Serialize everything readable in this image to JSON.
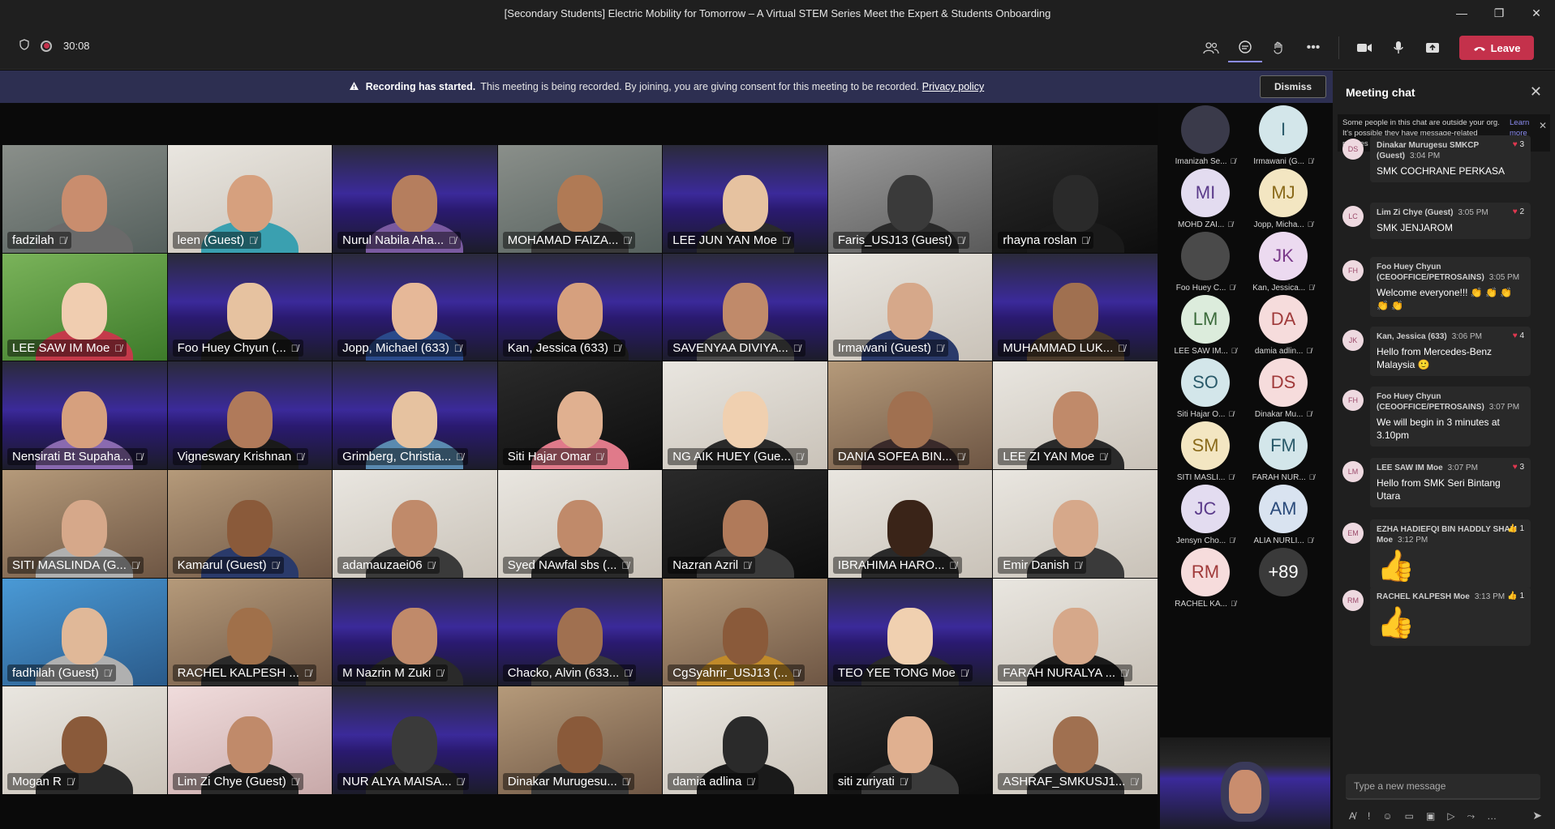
{
  "window": {
    "title": "[Secondary Students] Electric Mobility for Tomorrow – A Virtual STEM Series Meet the Expert & Students Onboarding",
    "minimize": "—",
    "maximize": "❐",
    "close": "✕"
  },
  "toolbar": {
    "timer": "30:08",
    "leave_label": "Leave",
    "icons": [
      "shield-icon",
      "record-icon",
      "participants-icon",
      "chat-icon",
      "reactions-icon",
      "more-icon",
      "camera-icon",
      "mic-icon",
      "share-icon",
      "phone-icon"
    ]
  },
  "banner": {
    "title": "Recording has started.",
    "message": "This meeting is being recorded. By joining, you are giving consent for this meeting to be recorded.",
    "link": "Privacy policy",
    "dismiss": "Dismiss"
  },
  "tiles": [
    {
      "name": "fadzilah",
      "bg": "bg-room",
      "skin": "#c98d6e",
      "cloth": "#6a6a6a"
    },
    {
      "name": "leen (Guest)",
      "bg": "bg-light",
      "skin": "#d6a07e",
      "cloth": "#3aa0b0"
    },
    {
      "name": "Nurul Nabila Aha...",
      "bg": "bg-purple",
      "skin": "#b57e5e",
      "cloth": "#7a5aa0"
    },
    {
      "name": "MOHAMAD FAIZA...",
      "bg": "bg-room",
      "skin": "#b07a55",
      "cloth": "#3a3a3a"
    },
    {
      "name": "LEE JUN YAN Moe",
      "bg": "bg-purple",
      "skin": "#e6c2a0",
      "cloth": "#2a2a2a"
    },
    {
      "name": "Faris_USJ13 (Guest)",
      "bg": "bg-grey",
      "skin": "#3a3a3a",
      "cloth": "#2a2a2a"
    },
    {
      "name": "rhayna roslan",
      "bg": "bg-dark",
      "skin": "#2a2a2a",
      "cloth": "#1a1a1a"
    },
    {
      "name": "LEE SAW IM Moe",
      "bg": "bg-green",
      "skin": "#f0cdb0",
      "cloth": "#c43a4a"
    },
    {
      "name": "Foo Huey Chyun (...",
      "bg": "bg-purple",
      "skin": "#e6c2a0",
      "cloth": "#1a1a1a"
    },
    {
      "name": "Jopp, Michael (633)",
      "bg": "bg-purple",
      "skin": "#e6b898",
      "cloth": "#2a4a8a"
    },
    {
      "name": "Kan, Jessica (633)",
      "bg": "bg-purple",
      "skin": "#d6a07e",
      "cloth": "#1a1a1a"
    },
    {
      "name": "SAVENYAA DIVIYA...",
      "bg": "bg-purple",
      "skin": "#c08a6a",
      "cloth": "#4a4a4a"
    },
    {
      "name": "Irmawani (Guest)",
      "bg": "bg-light",
      "skin": "#d6a88a",
      "cloth": "#2a3a6a"
    },
    {
      "name": "MUHAMMAD LUK...",
      "bg": "bg-purple",
      "skin": "#a07050",
      "cloth": "#4a3a2a"
    },
    {
      "name": "Nensirati Bt Supaha...",
      "bg": "bg-purple",
      "skin": "#d6a07e",
      "cloth": "#8a6ab0"
    },
    {
      "name": "Vigneswary Krishnan",
      "bg": "bg-purple",
      "skin": "#b07a5a",
      "cloth": "#1a1a1a"
    },
    {
      "name": "Grimberg, Christia...",
      "bg": "bg-purple",
      "skin": "#e6c2a0",
      "cloth": "#5a8ab0"
    },
    {
      "name": "Siti Hajar Omar",
      "bg": "bg-dark",
      "skin": "#e0b090",
      "cloth": "#e07a8a"
    },
    {
      "name": "NG AIK HUEY (Gue...",
      "bg": "bg-light",
      "skin": "#f0d0b0",
      "cloth": "#2a2a2a"
    },
    {
      "name": "DANIA SOFEA BIN...",
      "bg": "bg-warm",
      "skin": "#a07050",
      "cloth": "#3a2a2a"
    },
    {
      "name": "LEE ZI YAN Moe",
      "bg": "bg-light",
      "skin": "#c08a6a",
      "cloth": "#2a2a2a"
    },
    {
      "name": "SITI MASLINDA (G...",
      "bg": "bg-warm",
      "skin": "#d6a88a",
      "cloth": "#b0b0b0"
    },
    {
      "name": "Kamarul (Guest)",
      "bg": "bg-warm",
      "skin": "#8a5a3a",
      "cloth": "#2a3a6a"
    },
    {
      "name": "adamauzaei06",
      "bg": "bg-light",
      "skin": "#c08a6a",
      "cloth": "#3a3a3a"
    },
    {
      "name": "Syed NAwfal sbs (...",
      "bg": "bg-light",
      "skin": "#c08a6a",
      "cloth": "#2a2a2a"
    },
    {
      "name": "Nazran Azril",
      "bg": "bg-dark",
      "skin": "#b07a5a",
      "cloth": "#3a3a3a"
    },
    {
      "name": "IBRAHIMA HARO...",
      "bg": "bg-light",
      "skin": "#3a2418",
      "cloth": "#2a2a2a"
    },
    {
      "name": "Emir Danish",
      "bg": "bg-light",
      "skin": "#d6a88a",
      "cloth": "#3a3a3a"
    },
    {
      "name": "fadhilah (Guest)",
      "bg": "bg-blue",
      "skin": "#e0b898",
      "cloth": "#b0b0b0"
    },
    {
      "name": "RACHEL KALPESH ...",
      "bg": "bg-warm",
      "skin": "#a0704a",
      "cloth": "#2a2a2a"
    },
    {
      "name": "M Nazrin M Zuki",
      "bg": "bg-purple",
      "skin": "#c08a6a",
      "cloth": "#2a2a2a"
    },
    {
      "name": "Chacko, Alvin (633...",
      "bg": "bg-purple",
      "skin": "#a07050",
      "cloth": "#3a3a3a"
    },
    {
      "name": "CgSyahrir_USJ13 (...",
      "bg": "bg-warm",
      "skin": "#8a5a3a",
      "cloth": "#c08a2a"
    },
    {
      "name": "TEO YEE TONG Moe",
      "bg": "bg-purple",
      "skin": "#f0d0b0",
      "cloth": "#2a2a2a"
    },
    {
      "name": "FARAH NURALYA ...",
      "bg": "bg-light",
      "skin": "#d6a88a",
      "cloth": "#1a1a1a"
    },
    {
      "name": "Mogan R",
      "bg": "bg-light",
      "skin": "#8a5a3a",
      "cloth": "#2a2a2a"
    },
    {
      "name": "Lim Zi Chye (Guest)",
      "bg": "bg-pink",
      "skin": "#c08a6a",
      "cloth": "#2a2a2a"
    },
    {
      "name": "NUR ALYA MAISA...",
      "bg": "bg-purple",
      "skin": "#3a3a3a",
      "cloth": "#2a2a2a"
    },
    {
      "name": "Dinakar Murugesu...",
      "bg": "bg-warm",
      "skin": "#8a5a3a",
      "cloth": "#3a3a3a"
    },
    {
      "name": "damia adlina",
      "bg": "bg-light",
      "skin": "#2a2a2a",
      "cloth": "#1a1a1a"
    },
    {
      "name": "siti zuriyati",
      "bg": "bg-dark",
      "skin": "#e0b090",
      "cloth": "#3a3a3a"
    },
    {
      "name": "ASHRAF_SMKUSJ1...",
      "bg": "bg-light",
      "skin": "#a07050",
      "cloth": "#3a3a3a"
    }
  ],
  "roster": [
    {
      "initials": "",
      "name": "Imanizah Se...",
      "bg": "#3a3a4a",
      "fg": "#fff",
      "photo": true
    },
    {
      "initials": "I",
      "name": "Irmawani (G...",
      "bg": "#d3e6ea",
      "fg": "#2a5a6a"
    },
    {
      "initials": "MI",
      "name": "MOHD ZAI...",
      "bg": "#e3dcf0",
      "fg": "#5a3a8a"
    },
    {
      "initials": "MJ",
      "name": "Jopp, Micha...",
      "bg": "#f3e6c2",
      "fg": "#8a6a1a"
    },
    {
      "initials": "",
      "name": "Foo Huey C...",
      "bg": "#4a4a4a",
      "fg": "#fff",
      "photo": true
    },
    {
      "initials": "JK",
      "name": "Kan, Jessica...",
      "bg": "#ecdaf0",
      "fg": "#7a3a8a"
    },
    {
      "initials": "LM",
      "name": "LEE SAW IM...",
      "bg": "#dcecdc",
      "fg": "#3a6a3a"
    },
    {
      "initials": "DA",
      "name": "damia adlin...",
      "bg": "#f6dcdc",
      "fg": "#a03a3a"
    },
    {
      "initials": "SO",
      "name": "Siti Hajar O...",
      "bg": "#d3e6ea",
      "fg": "#2a5a6a"
    },
    {
      "initials": "DS",
      "name": "Dinakar Mu...",
      "bg": "#f6dcdc",
      "fg": "#a03a3a"
    },
    {
      "initials": "SM",
      "name": "SITI MASLI...",
      "bg": "#f3e6c2",
      "fg": "#8a6a1a"
    },
    {
      "initials": "FM",
      "name": "FARAH NUR...",
      "bg": "#d3e6ea",
      "fg": "#2a5a6a"
    },
    {
      "initials": "JC",
      "name": "Jensyn Cho...",
      "bg": "#e3dcf0",
      "fg": "#5a3a8a"
    },
    {
      "initials": "AM",
      "name": "ALIA NURLI...",
      "bg": "#d9e3f0",
      "fg": "#2a4a7a"
    },
    {
      "initials": "RM",
      "name": "RACHEL KA...",
      "bg": "#f6dcdc",
      "fg": "#a03a3a"
    },
    {
      "initials": "+89",
      "name": "",
      "bg": "#3a3a3a",
      "fg": "#fff"
    }
  ],
  "chat": {
    "title": "Meeting chat",
    "notice": "Some people in this chat are outside your org. It's possible they have message-related policies that will apply to the chat.",
    "learn_more": "Learn more",
    "input_placeholder": "Type a new message",
    "messages": [
      {
        "initials": "DS",
        "sender": "Dinakar Murugesu SMKCP (Guest)",
        "time": "3:04 PM",
        "text": "SMK COCHRANE PERKASA",
        "react": "♥",
        "count": "3"
      },
      {
        "initials": "LC",
        "sender": "Lim Zi Chye (Guest)",
        "time": "3:05 PM",
        "text": "SMK JENJAROM",
        "react": "♥",
        "count": "2"
      },
      {
        "initials": "FH",
        "sender": "Foo Huey Chyun (CEOOFFICE/PETROSAINS)",
        "time": "3:05 PM",
        "text": "Welcome everyone!!! 👏 👏 👏 👏 👏",
        "react": "",
        "count": ""
      },
      {
        "initials": "JK",
        "sender": "Kan, Jessica (633)",
        "time": "3:06 PM",
        "text": "Hello from Mercedes-Benz Malaysia 🙂",
        "react": "♥",
        "count": "4"
      },
      {
        "initials": "FH",
        "sender": "Foo Huey Chyun (CEOOFFICE/PETROSAINS)",
        "time": "3:07 PM",
        "text": "We will begin in 3 minutes at 3.10pm",
        "react": "",
        "count": ""
      },
      {
        "initials": "LM",
        "sender": "LEE SAW IM Moe",
        "time": "3:07 PM",
        "text": "Hello from SMK Seri Bintang Utara",
        "react": "♥",
        "count": "3"
      },
      {
        "initials": "EM",
        "sender": "EZHA HADIEFQI BIN HADDLY SHAM Moe",
        "time": "3:12 PM",
        "text": "👍",
        "react": "👍",
        "count": "1"
      },
      {
        "initials": "RM",
        "sender": "RACHEL KALPESH Moe",
        "time": "3:13 PM",
        "text": "👍",
        "react": "👍",
        "count": "1"
      }
    ]
  }
}
